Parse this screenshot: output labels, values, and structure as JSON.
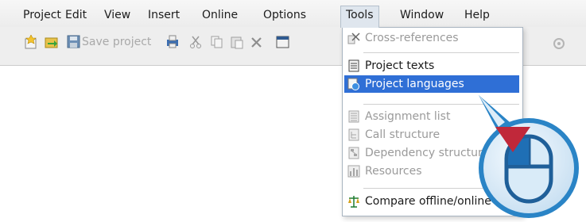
{
  "menubar": {
    "items": [
      "Project",
      "Edit",
      "View",
      "Insert",
      "Online",
      "Options",
      "Tools",
      "Window",
      "Help"
    ],
    "active": "Tools"
  },
  "toolbar": {
    "save_label": "Save project",
    "icons": [
      "new-project-icon",
      "open-project-icon",
      "save-icon",
      "print-icon",
      "cut-icon",
      "copy-icon",
      "paste-icon",
      "delete-icon",
      "window-icon",
      "properties-icon"
    ]
  },
  "tools_menu": {
    "items": [
      {
        "label": "Cross-references",
        "icon": "cross-references-icon",
        "enabled": false
      },
      {
        "label": "Project texts",
        "icon": "project-texts-icon",
        "enabled": true
      },
      {
        "label": "Project languages",
        "icon": "project-languages-icon",
        "enabled": true,
        "highlighted": true
      },
      {
        "label": "Assignment list",
        "icon": "assignment-list-icon",
        "enabled": false
      },
      {
        "label": "Call structure",
        "icon": "call-structure-icon",
        "enabled": false
      },
      {
        "label": "Dependency structure",
        "icon": "dependency-structure-icon",
        "enabled": false
      },
      {
        "label": "Resources",
        "icon": "resources-icon",
        "enabled": false
      },
      {
        "label": "Compare offline/online",
        "icon": "compare-icon",
        "enabled": true
      }
    ]
  },
  "colors": {
    "highlight": "#2f6fd6",
    "callout_ring": "#2a84c6",
    "arrow": "#c0283a",
    "mouse_fill": "#1f6fb5"
  }
}
